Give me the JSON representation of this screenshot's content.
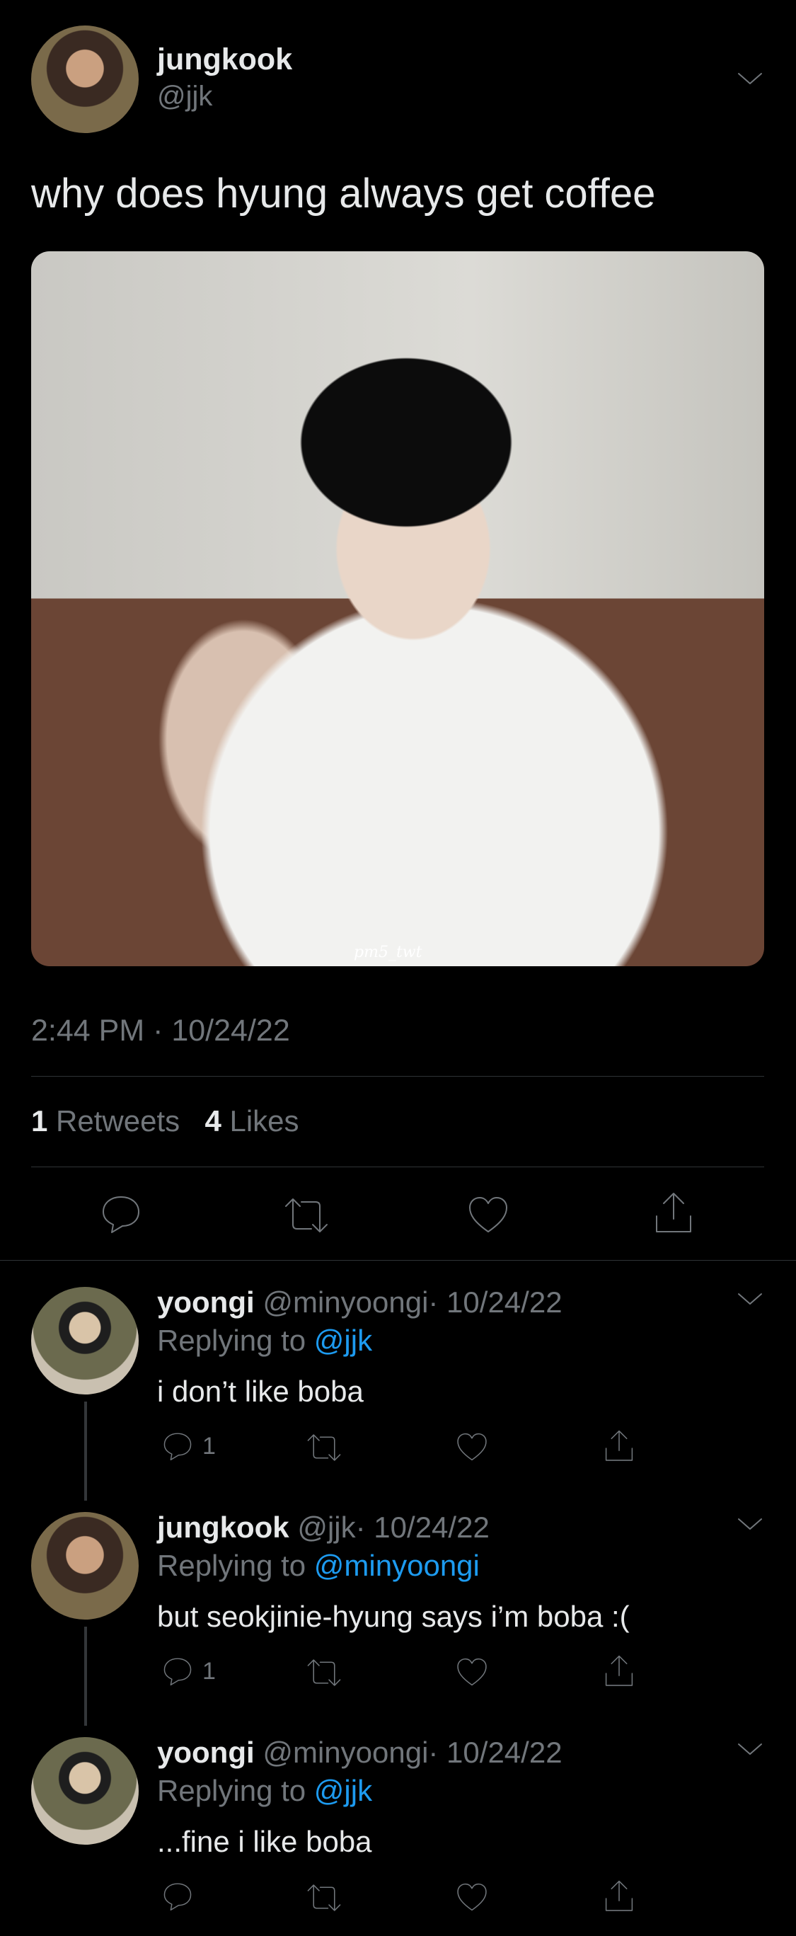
{
  "tweet": {
    "author_name": "jungkook",
    "author_handle": "@jjk",
    "text": "why does hyung always get coffee",
    "image_watermark": "pm5_twt",
    "time": "2:44 PM · 10/24/22",
    "stats": {
      "retweets_count": "1",
      "retweets_label": "Retweets",
      "likes_count": "4",
      "likes_label": "Likes"
    }
  },
  "replies": [
    {
      "name": "yoongi",
      "handle": "@minyoongi",
      "date": "· 10/24/22",
      "replying_prefix": "Replying to",
      "replying_to": "@jjk",
      "text": "i don’t like boba",
      "reply_count": "1"
    },
    {
      "name": "jungkook",
      "handle": "@jjk",
      "date": "· 10/24/22",
      "replying_prefix": "Replying to",
      "replying_to": "@minyoongi",
      "text": "but seokjinie-hyung says i’m boba :(",
      "reply_count": "1"
    },
    {
      "name": "yoongi",
      "handle": "@minyoongi",
      "date": "· 10/24/22",
      "replying_prefix": "Replying to",
      "replying_to": "@jjk",
      "text": "...fine i like boba",
      "reply_count": ""
    }
  ],
  "colors": {
    "background": "#000000",
    "text": "#e7e9ea",
    "muted": "#71767b",
    "link": "#1d9bf0",
    "divider": "#2f3336"
  },
  "icons": [
    "chevron-down-icon",
    "reply-icon",
    "retweet-icon",
    "like-icon",
    "share-icon"
  ]
}
